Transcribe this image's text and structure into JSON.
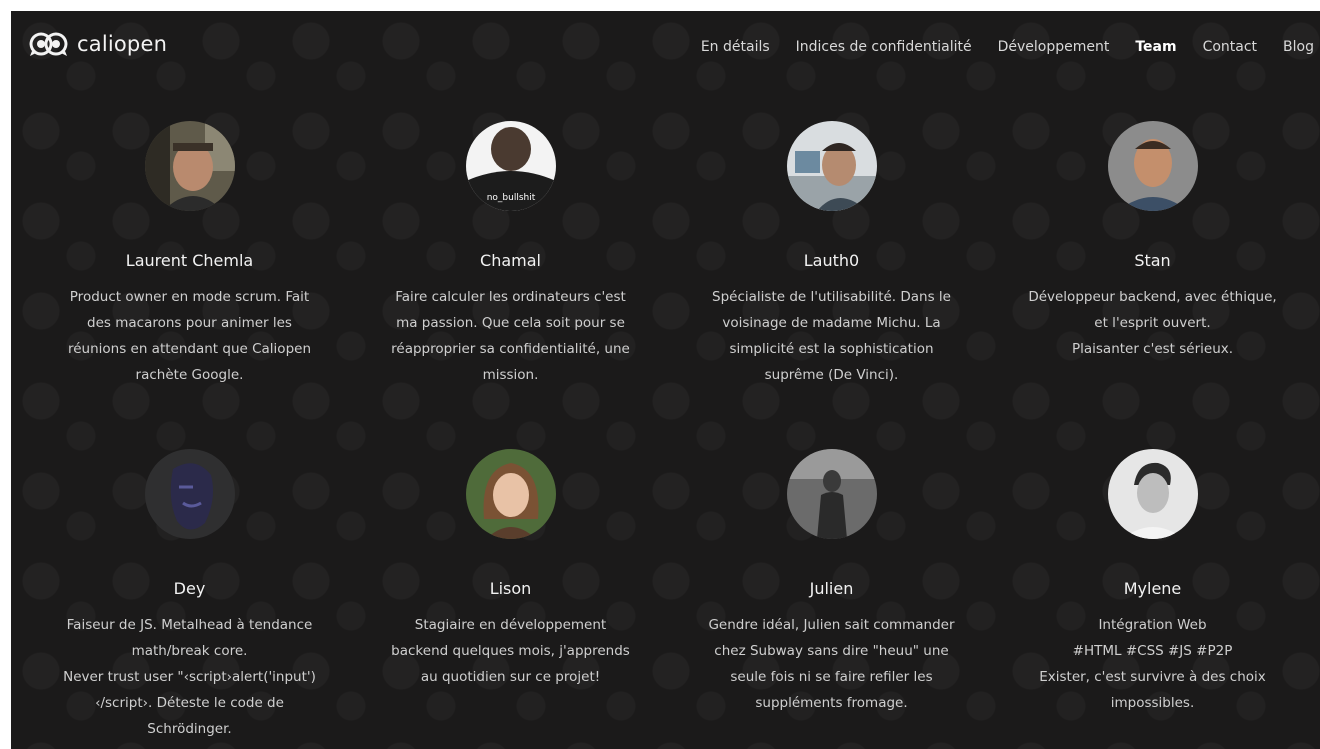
{
  "header": {
    "logo_text": "caliopen",
    "logo_icon": "caliopen-logo-icon",
    "nav": [
      {
        "label": "En détails",
        "active": false
      },
      {
        "label": "Indices de confidentialité",
        "active": false
      },
      {
        "label": "Développement",
        "active": false
      },
      {
        "label": "Team",
        "active": true
      },
      {
        "label": "Contact",
        "active": false
      },
      {
        "label": "Blog",
        "active": false
      }
    ]
  },
  "team": [
    {
      "name": "Laurent Chemla",
      "bio": "Product owner en mode scrum. Fait\ndes macarons pour animer les\nréunions en attendant que Caliopen\nrachète Google."
    },
    {
      "name": "Chamal",
      "bio": "Faire calculer les ordinateurs c'est\nma passion. Que cela soit pour se\nréapproprier sa confidentialité, une\nmission."
    },
    {
      "name": "Lauth0",
      "bio": "Spécialiste de l'utilisabilité. Dans le\nvoisinage de madame Michu. La\nsimplicité est la sophistication\nsuprême (De Vinci)."
    },
    {
      "name": "Stan",
      "bio": "Développeur backend, avec éthique,\net l'esprit ouvert.\nPlaisanter c'est sérieux."
    },
    {
      "name": "Dey",
      "bio": "Faiseur de JS. Metalhead à tendance\nmath/break core.\nNever trust user \"‹script›alert('input')\n‹/script›. Déteste le code de\nSchrödinger."
    },
    {
      "name": "Lison",
      "bio": "Stagiaire en développement\nbackend quelques mois, j'apprends\nau quotidien sur ce projet!"
    },
    {
      "name": "Julien",
      "bio": "Gendre idéal, Julien sait commander\nchez Subway sans dire \"heuu\" une\nseule fois ni se faire refiler les\nsuppléments fromage."
    },
    {
      "name": "Mylene",
      "bio": "Intégration Web\n#HTML #CSS #JS #P2P\nExister, c'est survivre à des choix\nimpossibles."
    }
  ],
  "avatar_t_shirt_text": "no_bullshit"
}
